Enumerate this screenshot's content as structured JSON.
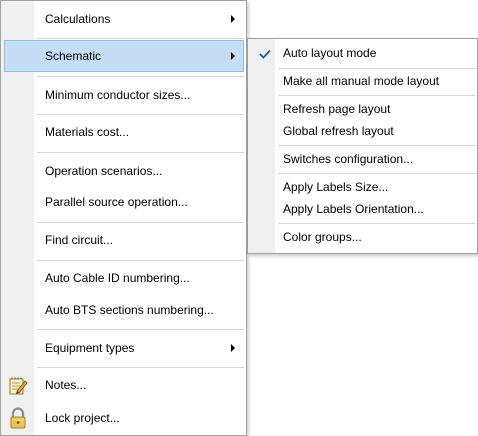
{
  "main_menu": {
    "items": [
      {
        "label": "Calculations",
        "has_submenu": true
      },
      {
        "label": "Schematic",
        "has_submenu": true,
        "highlighted": true
      },
      {
        "label": "Minimum conductor sizes..."
      },
      {
        "label": "Materials cost..."
      },
      {
        "label": "Operation scenarios..."
      },
      {
        "label": "Parallel source operation..."
      },
      {
        "label": "Find circuit..."
      },
      {
        "label": "Auto Cable ID numbering..."
      },
      {
        "label": "Auto BTS sections numbering..."
      },
      {
        "label": "Equipment types",
        "has_submenu": true
      },
      {
        "label": "Notes...",
        "icon": "notes-icon"
      },
      {
        "label": "Lock project...",
        "icon": "padlock-icon"
      }
    ]
  },
  "schematic_submenu": {
    "items": [
      {
        "label": "Auto layout mode",
        "checked": true
      },
      {
        "label": "Make all manual mode layout"
      },
      {
        "label": "Refresh page layout"
      },
      {
        "label": "Global refresh layout"
      },
      {
        "label": "Switches configuration..."
      },
      {
        "label": "Apply Labels Size..."
      },
      {
        "label": "Apply Labels Orientation..."
      },
      {
        "label": "Color groups..."
      }
    ]
  },
  "colors": {
    "highlight_background": "#c5def6",
    "highlight_border": "#90bde8",
    "gutter": "#f0f0f0",
    "separator": "#d7d7d7",
    "check_mark": "#1e5aa8"
  }
}
